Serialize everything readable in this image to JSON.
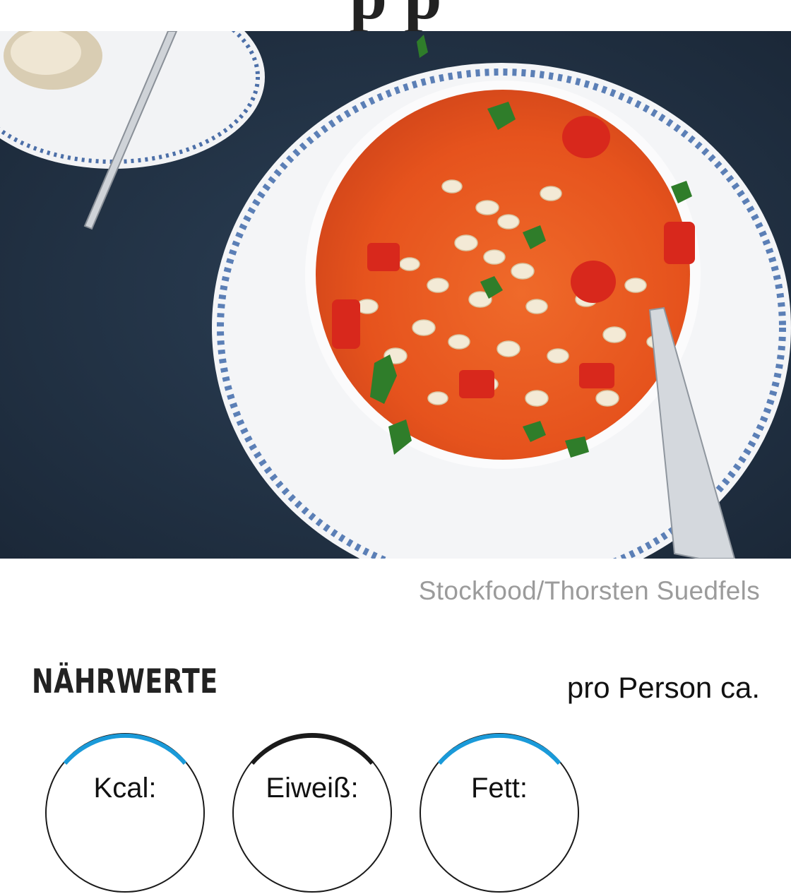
{
  "page": {
    "title_partial": "p p"
  },
  "hero": {
    "credit": "Stockfood/Thorsten Suedfels"
  },
  "nutrition": {
    "heading": "NÄHRWERTE",
    "per_person": "pro Person ca.",
    "items": [
      {
        "label": "Kcal:",
        "ring_color": "#1a9ad9"
      },
      {
        "label": "Eiweiß:",
        "ring_color": "#1a1a1a"
      },
      {
        "label": "Fett:",
        "ring_color": "#1a9ad9"
      }
    ]
  },
  "colors": {
    "accent_blue": "#1a9ad9",
    "text_dark": "#222222",
    "credit_gray": "#9b9b9b",
    "tablecloth": "#233447"
  }
}
